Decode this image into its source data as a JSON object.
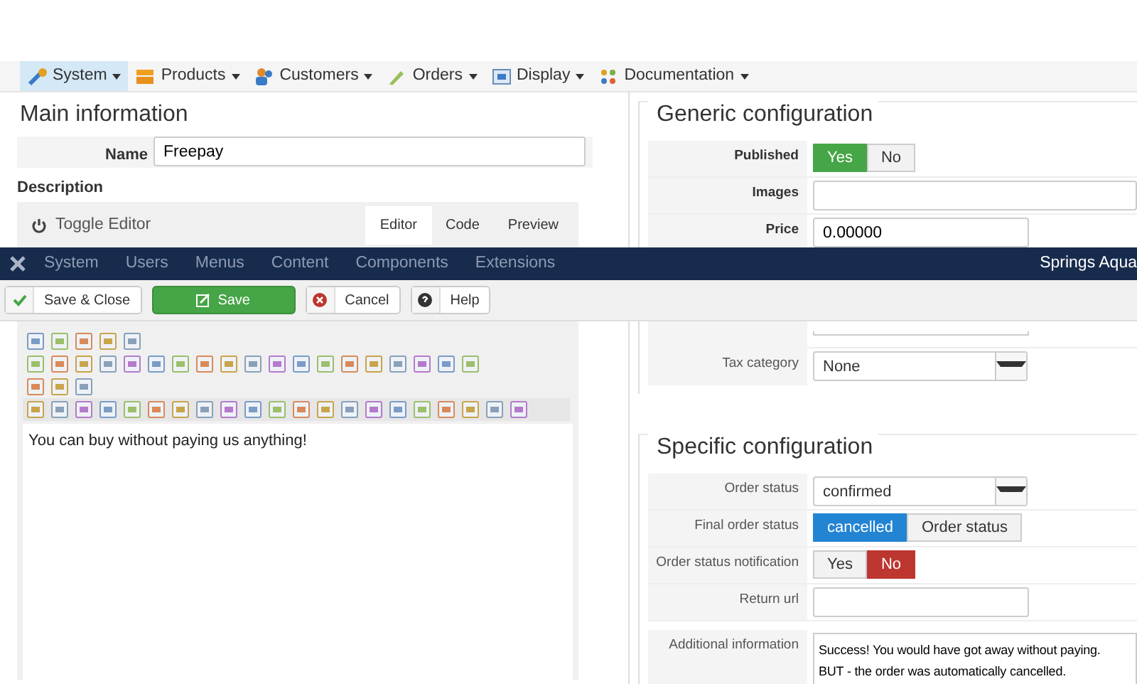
{
  "top_menu": [
    {
      "label": "System",
      "selected": true
    },
    {
      "label": "Products",
      "selected": false
    },
    {
      "label": "Customers",
      "selected": false
    },
    {
      "label": "Orders",
      "selected": false
    },
    {
      "label": "Display",
      "selected": false
    },
    {
      "label": "Documentation",
      "selected": false
    }
  ],
  "main_information": {
    "legend": "Main information",
    "name_label": "Name",
    "name_value": "Freepay",
    "description_label": "Description",
    "toggle_editor": "Toggle Editor",
    "editor_tabs": [
      {
        "label": "Editor",
        "selected": true
      },
      {
        "label": "Code",
        "selected": false
      },
      {
        "label": "Preview",
        "selected": false
      }
    ],
    "editor_content": "You can buy without paying us anything!"
  },
  "generic_configuration": {
    "legend": "Generic configuration",
    "fields": [
      {
        "kind": "yes-no-toggle",
        "label": "Published",
        "required": true,
        "options": [
          {
            "label": "Yes",
            "selected": true
          },
          {
            "label": "No",
            "selected": false
          }
        ]
      },
      {
        "kind": "media",
        "label": "Images",
        "required": true
      },
      {
        "kind": "text",
        "label": "Price",
        "required": true,
        "value": "0.00000"
      },
      {
        "kind": "covered-row"
      },
      {
        "kind": "select",
        "label": "Tax category",
        "required": false,
        "value": "None"
      }
    ]
  },
  "specific_configuration": {
    "legend": "Specific configuration",
    "fields": [
      {
        "kind": "select",
        "label": "Order status",
        "required": false,
        "value": "confirmed"
      },
      {
        "kind": "choice-toggle",
        "label": "Final order status",
        "required": false,
        "options": [
          {
            "label": "cancelled",
            "selected": true
          },
          {
            "label": "Order status",
            "selected": false
          }
        ]
      },
      {
        "kind": "yes-no-toggle",
        "label": "Order status notification",
        "required": false,
        "options": [
          {
            "label": "Yes",
            "selected": false
          },
          {
            "label": "No",
            "selected": true
          }
        ]
      },
      {
        "kind": "text",
        "label": "Return url",
        "required": false
      },
      {
        "kind": "textarea",
        "label": "Additional information",
        "required": false,
        "value": "Success! You would have got away without paying.\nBUT - the order was automatically cancelled."
      }
    ]
  },
  "admin_bar": {
    "items": [
      "System",
      "Users",
      "Menus",
      "Content",
      "Components",
      "Extensions"
    ],
    "site_name": "Springs Aqua"
  },
  "toolbar": {
    "buttons": [
      {
        "kind": "save-close",
        "label": "Save & Close"
      },
      {
        "kind": "save",
        "label": "Save"
      },
      {
        "kind": "cancel",
        "label": "Cancel"
      },
      {
        "kind": "help",
        "label": "Help"
      }
    ]
  }
}
